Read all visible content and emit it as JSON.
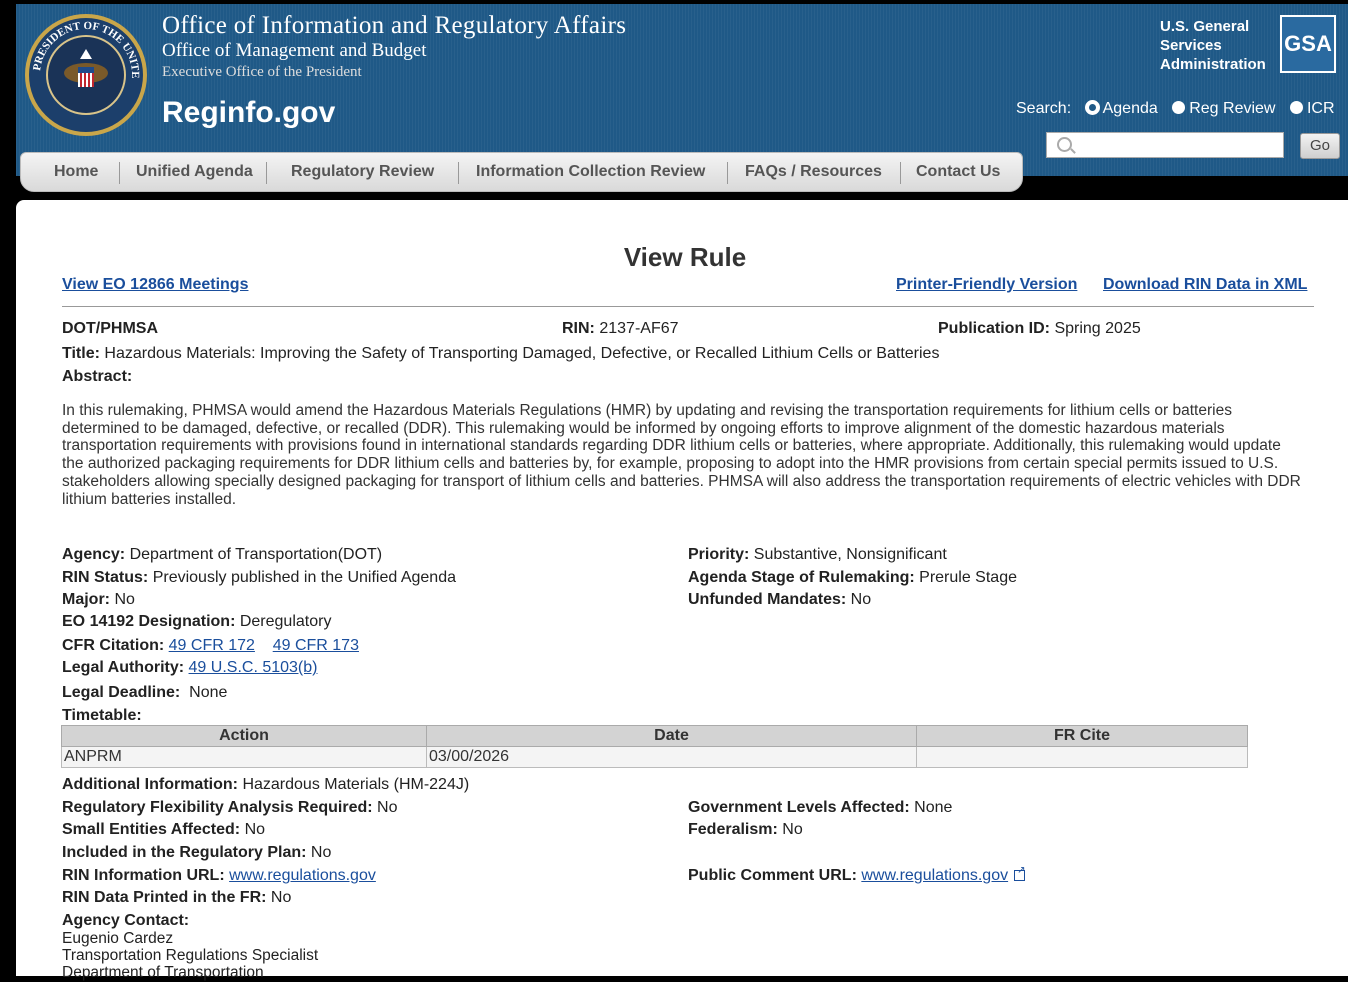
{
  "header": {
    "title_line1": "Office of Information and Regulatory Affairs",
    "title_line2": "Office of Management and Budget",
    "title_line3": "Executive Office of the President",
    "site_name": "Reginfo.gov",
    "seal_text": "PRESIDENT OF THE UNITED STATES",
    "gsa_text": "U.S. General\nServices\nAdministration",
    "gsa_logo": "GSA",
    "search_label": "Search:",
    "search_options": [
      "Agenda",
      "Reg Review",
      "ICR"
    ],
    "search_selected": "Agenda",
    "go_label": "Go"
  },
  "nav": {
    "items": [
      "Home",
      "Unified Agenda",
      "Regulatory Review",
      "Information Collection Review",
      "FAQs / Resources",
      "Contact Us"
    ]
  },
  "page": {
    "title": "View Rule",
    "eo_link": "View EO 12866 Meetings",
    "printer_link": "Printer-Friendly Version",
    "xml_link": "Download RIN Data in XML"
  },
  "rule": {
    "agency_code": "DOT/PHMSA",
    "rin_label": "RIN:",
    "rin": "2137-AF67",
    "pub_label": "Publication ID:",
    "pub": "Spring 2025",
    "title_label": "Title:",
    "title": "Hazardous Materials: Improving the Safety of Transporting Damaged, Defective, or Recalled Lithium Cells or Batteries",
    "abstract_label": "Abstract:",
    "abstract": "In this rulemaking, PHMSA would amend the Hazardous Materials Regulations (HMR) by updating and revising the transportation requirements for lithium cells or batteries determined to be damaged, defective, or recalled (DDR). This rulemaking would be informed by ongoing efforts to improve alignment of the domestic hazardous materials transportation requirements with provisions found in international standards regarding DDR lithium cells or batteries, where appropriate. Additionally, this rulemaking would update the authorized packaging requirements for DDR lithium cells and batteries by, for example, proposing to adopt into the HMR provisions from certain special permits issued to U.S. stakeholders allowing specially designed packaging for transport of lithium cells and batteries. PHMSA will also address the transportation requirements of electric vehicles with DDR lithium batteries installed.",
    "agency_label": "Agency:",
    "agency": "Department of Transportation(DOT)",
    "priority_label": "Priority:",
    "priority": "Substantive, Nonsignificant",
    "rin_status_label": "RIN Status:",
    "rin_status": "Previously published in the Unified Agenda",
    "stage_label": "Agenda Stage of Rulemaking:",
    "stage": "Prerule Stage",
    "major_label": "Major:",
    "major": "No",
    "unfunded_label": "Unfunded Mandates:",
    "unfunded": "No",
    "eo_label": "EO 14192 Designation:",
    "eo": "Deregulatory",
    "cfr_label": "CFR Citation:",
    "cfr": [
      "49 CFR 172",
      "49 CFR 173"
    ],
    "legal_auth_label": "Legal Authority:",
    "legal_auth": "49 U.S.C. 5103(b)",
    "deadline_label": "Legal Deadline:",
    "deadline": "None",
    "timetable_label": "Timetable:",
    "timetable_headers": [
      "Action",
      "Date",
      "FR Cite"
    ],
    "timetable_rows": [
      [
        "ANPRM",
        "03/00/2026",
        ""
      ]
    ],
    "addl_label": "Additional Information:",
    "addl": "Hazardous Materials (HM-224J)",
    "rfa_label": "Regulatory Flexibility Analysis Required:",
    "rfa": "No",
    "gov_label": "Government Levels Affected:",
    "gov": "None",
    "small_label": "Small Entities Affected:",
    "small": "No",
    "fed_label": "Federalism:",
    "fed": "No",
    "regplan_label": "Included in the Regulatory Plan:",
    "regplan": "No",
    "rin_url_label": "RIN Information URL:",
    "rin_url": "www.regulations.gov",
    "comment_label": "Public Comment URL:",
    "comment_url": "www.regulations.gov",
    "printed_label": "RIN Data Printed in the FR:",
    "printed": "No",
    "contact_label": "Agency Contact:",
    "contact": [
      "Eugenio Cardez",
      "Transportation Regulations Specialist",
      "Department of Transportation"
    ]
  }
}
